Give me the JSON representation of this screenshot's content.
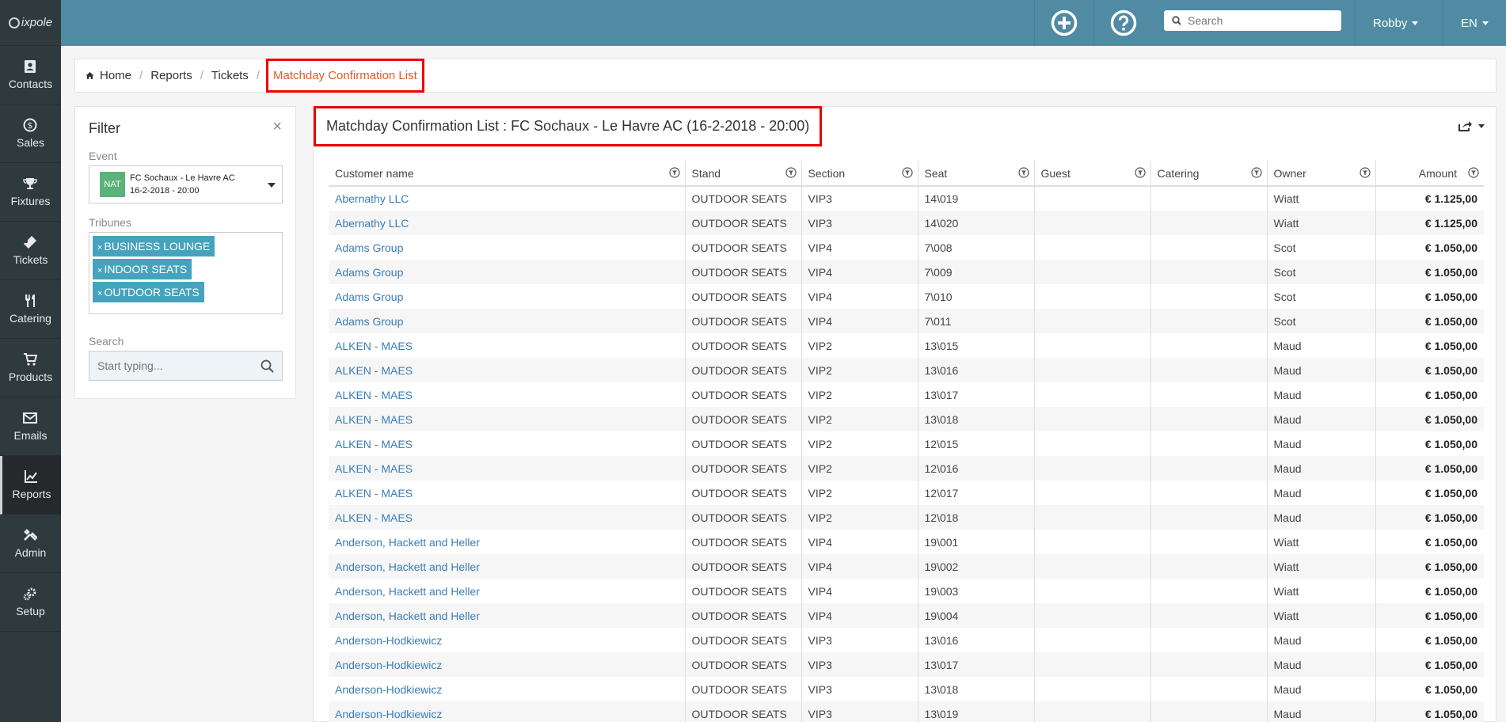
{
  "app": {
    "logo_text": "ixpole"
  },
  "sidebar": {
    "items": [
      {
        "label": "Contacts",
        "icon": "contacts-icon"
      },
      {
        "label": "Sales",
        "icon": "sales-icon"
      },
      {
        "label": "Fixtures",
        "icon": "trophy-icon"
      },
      {
        "label": "Tickets",
        "icon": "ticket-icon"
      },
      {
        "label": "Catering",
        "icon": "cutlery-icon"
      },
      {
        "label": "Products",
        "icon": "cart-icon"
      },
      {
        "label": "Emails",
        "icon": "envelope-icon"
      },
      {
        "label": "Reports",
        "icon": "chart-icon",
        "active": true
      },
      {
        "label": "Admin",
        "icon": "tools-icon"
      },
      {
        "label": "Setup",
        "icon": "gears-icon"
      }
    ]
  },
  "topbar": {
    "search_placeholder": "Search",
    "user": "Robby",
    "lang": "EN"
  },
  "breadcrumb": {
    "home": "Home",
    "reports": "Reports",
    "tickets": "Tickets",
    "current": "Matchday Confirmation List"
  },
  "filter": {
    "title": "Filter",
    "close": "×",
    "event_label": "Event",
    "event_badge": "NAT",
    "event_name": "FC Sochaux - Le Havre AC",
    "event_date": "16-2-2018 - 20:00",
    "tribunes_label": "Tribunes",
    "tribunes": [
      "BUSINESS LOUNGE",
      "INDOOR SEATS",
      "OUTDOOR SEATS"
    ],
    "search_label": "Search",
    "search_placeholder": "Start typing..."
  },
  "main": {
    "title": "Matchday Confirmation List : FC Sochaux - Le Havre AC (16-2-2018 - 20:00)",
    "columns": [
      "Customer name",
      "Stand",
      "Section",
      "Seat",
      "Guest",
      "Catering",
      "Owner",
      "Amount"
    ],
    "rows": [
      [
        "Abernathy LLC",
        "OUTDOOR SEATS",
        "VIP3",
        "14\\019",
        "",
        "",
        "Wiatt",
        "€ 1.125,00"
      ],
      [
        "Abernathy LLC",
        "OUTDOOR SEATS",
        "VIP3",
        "14\\020",
        "",
        "",
        "Wiatt",
        "€ 1.125,00"
      ],
      [
        "Adams Group",
        "OUTDOOR SEATS",
        "VIP4",
        "7\\008",
        "",
        "",
        "Scot",
        "€ 1.050,00"
      ],
      [
        "Adams Group",
        "OUTDOOR SEATS",
        "VIP4",
        "7\\009",
        "",
        "",
        "Scot",
        "€ 1.050,00"
      ],
      [
        "Adams Group",
        "OUTDOOR SEATS",
        "VIP4",
        "7\\010",
        "",
        "",
        "Scot",
        "€ 1.050,00"
      ],
      [
        "Adams Group",
        "OUTDOOR SEATS",
        "VIP4",
        "7\\011",
        "",
        "",
        "Scot",
        "€ 1.050,00"
      ],
      [
        "ALKEN - MAES",
        "OUTDOOR SEATS",
        "VIP2",
        "13\\015",
        "",
        "",
        "Maud",
        "€ 1.050,00"
      ],
      [
        "ALKEN - MAES",
        "OUTDOOR SEATS",
        "VIP2",
        "13\\016",
        "",
        "",
        "Maud",
        "€ 1.050,00"
      ],
      [
        "ALKEN - MAES",
        "OUTDOOR SEATS",
        "VIP2",
        "13\\017",
        "",
        "",
        "Maud",
        "€ 1.050,00"
      ],
      [
        "ALKEN - MAES",
        "OUTDOOR SEATS",
        "VIP2",
        "13\\018",
        "",
        "",
        "Maud",
        "€ 1.050,00"
      ],
      [
        "ALKEN - MAES",
        "OUTDOOR SEATS",
        "VIP2",
        "12\\015",
        "",
        "",
        "Maud",
        "€ 1.050,00"
      ],
      [
        "ALKEN - MAES",
        "OUTDOOR SEATS",
        "VIP2",
        "12\\016",
        "",
        "",
        "Maud",
        "€ 1.050,00"
      ],
      [
        "ALKEN - MAES",
        "OUTDOOR SEATS",
        "VIP2",
        "12\\017",
        "",
        "",
        "Maud",
        "€ 1.050,00"
      ],
      [
        "ALKEN - MAES",
        "OUTDOOR SEATS",
        "VIP2",
        "12\\018",
        "",
        "",
        "Maud",
        "€ 1.050,00"
      ],
      [
        "Anderson, Hackett and Heller",
        "OUTDOOR SEATS",
        "VIP4",
        "19\\001",
        "",
        "",
        "Wiatt",
        "€ 1.050,00"
      ],
      [
        "Anderson, Hackett and Heller",
        "OUTDOOR SEATS",
        "VIP4",
        "19\\002",
        "",
        "",
        "Wiatt",
        "€ 1.050,00"
      ],
      [
        "Anderson, Hackett and Heller",
        "OUTDOOR SEATS",
        "VIP4",
        "19\\003",
        "",
        "",
        "Wiatt",
        "€ 1.050,00"
      ],
      [
        "Anderson, Hackett and Heller",
        "OUTDOOR SEATS",
        "VIP4",
        "19\\004",
        "",
        "",
        "Wiatt",
        "€ 1.050,00"
      ],
      [
        "Anderson-Hodkiewicz",
        "OUTDOOR SEATS",
        "VIP3",
        "13\\016",
        "",
        "",
        "Maud",
        "€ 1.050,00"
      ],
      [
        "Anderson-Hodkiewicz",
        "OUTDOOR SEATS",
        "VIP3",
        "13\\017",
        "",
        "",
        "Maud",
        "€ 1.050,00"
      ],
      [
        "Anderson-Hodkiewicz",
        "OUTDOOR SEATS",
        "VIP3",
        "13\\018",
        "",
        "",
        "Maud",
        "€ 1.050,00"
      ],
      [
        "Anderson-Hodkiewicz",
        "OUTDOOR SEATS",
        "VIP3",
        "13\\019",
        "",
        "",
        "Maud",
        "€ 1.050,00"
      ]
    ]
  },
  "colors": {
    "topbar": "#508ba3",
    "sidebar": "#2f3a3f",
    "link": "#3a7db8",
    "tag": "#46a3bd",
    "highlight": "#e00000",
    "breadcrumb_current": "#e05a2b"
  }
}
